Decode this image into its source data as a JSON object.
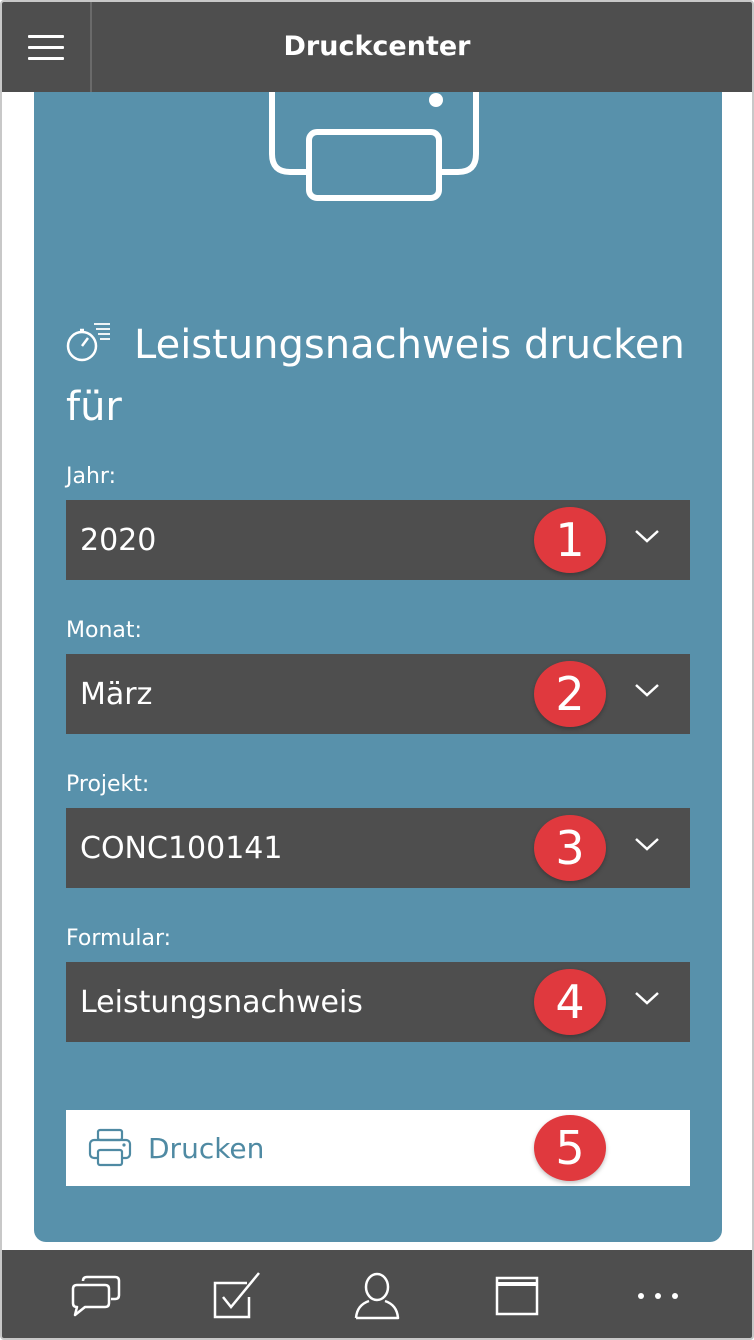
{
  "header": {
    "title": "Druckcenter"
  },
  "section": {
    "title": "Leistungsnachweis drucken für"
  },
  "fields": [
    {
      "label": "Jahr:",
      "value": "2020",
      "badge": "1"
    },
    {
      "label": "Monat:",
      "value": "März",
      "badge": "2"
    },
    {
      "label": "Projekt:",
      "value": "CONC100141",
      "badge": "3"
    },
    {
      "label": "Formular:",
      "value": "Leistungsnachweis",
      "badge": "4"
    }
  ],
  "print_button": {
    "label": "Drucken",
    "badge": "5"
  },
  "colors": {
    "header": "#4e4e4e",
    "card": "#5891ab",
    "badge": "#e0393e",
    "accent_text": "#4f8aa3"
  },
  "bottom_tabs": [
    "chat-icon",
    "checkbox-icon",
    "user-icon",
    "window-icon",
    "more-icon"
  ]
}
